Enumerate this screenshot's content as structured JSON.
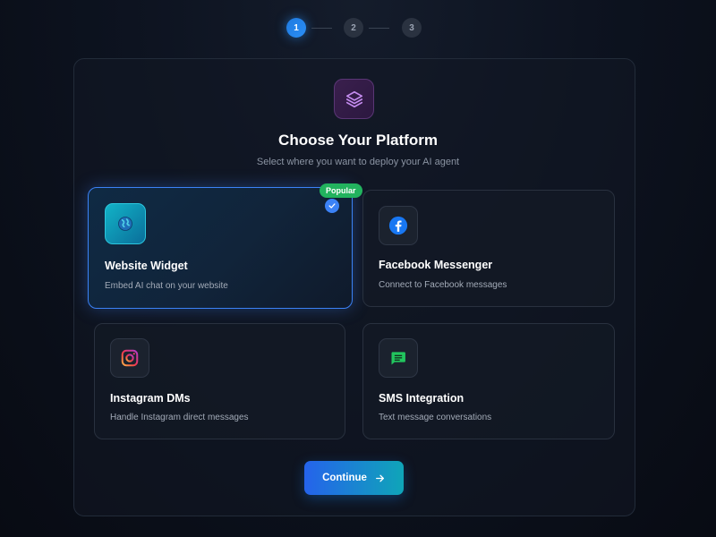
{
  "stepper": {
    "steps": [
      {
        "label": "1",
        "state": "active"
      },
      {
        "label": "2",
        "state": "inactive"
      },
      {
        "label": "3",
        "state": "inactive"
      }
    ]
  },
  "header": {
    "icon": "layers-icon",
    "title": "Choose Your Platform",
    "subtitle": "Select where you want to deploy your AI agent"
  },
  "platforms": [
    {
      "id": "website",
      "title": "Website Widget",
      "description": "Embed AI chat on your website",
      "icon": "globe-icon",
      "badge": "Popular",
      "selected": true
    },
    {
      "id": "facebook",
      "title": "Facebook Messenger",
      "description": "Connect to Facebook messages",
      "icon": "facebook-icon",
      "selected": false
    },
    {
      "id": "instagram",
      "title": "Instagram DMs",
      "description": "Handle Instagram direct messages",
      "icon": "instagram-icon",
      "selected": false
    },
    {
      "id": "sms",
      "title": "SMS Integration",
      "description": "Text message conversations",
      "icon": "chat-icon",
      "selected": false
    }
  ],
  "actions": {
    "continue_label": "Continue"
  },
  "colors": {
    "accent": "#3b82f6",
    "badge": "#22b35e",
    "background": "#0d1320"
  }
}
